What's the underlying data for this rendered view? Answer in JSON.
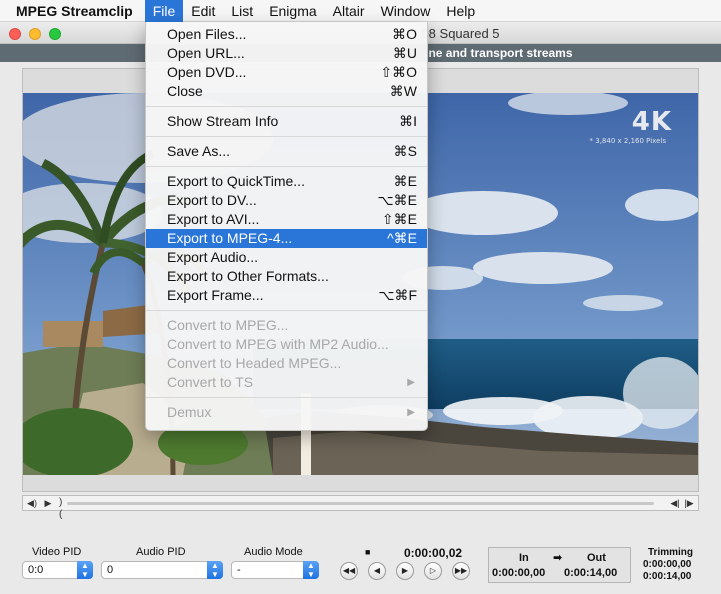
{
  "menubar": {
    "app": "MPEG Streamclip",
    "menus": [
      "File",
      "Edit",
      "List",
      "Enigma",
      "Altair",
      "Window",
      "Help"
    ]
  },
  "window": {
    "title": "08 Squared 5",
    "subtitle": "ne and transport streams"
  },
  "video": {
    "badge": "4K",
    "badge_sub": "* 3,840 x 2,160 Pixels"
  },
  "file_menu": {
    "items": [
      {
        "label": "Open Files...",
        "shortcut": "⌘O"
      },
      {
        "label": "Open URL...",
        "shortcut": "⌘U"
      },
      {
        "label": "Open DVD...",
        "shortcut": "⇧⌘O"
      },
      {
        "label": "Close",
        "shortcut": "⌘W"
      },
      {
        "label": "Show Stream Info",
        "shortcut": "⌘I"
      },
      {
        "label": "Save As...",
        "shortcut": "⌘S"
      },
      {
        "label": "Export to QuickTime...",
        "shortcut": "⌘E"
      },
      {
        "label": "Export to DV...",
        "shortcut": "⌥⌘E"
      },
      {
        "label": "Export to AVI...",
        "shortcut": "⇧⌘E"
      },
      {
        "label": "Export to MPEG-4...",
        "shortcut": "^⌘E"
      },
      {
        "label": "Export Audio...",
        "shortcut": ""
      },
      {
        "label": "Export to Other Formats...",
        "shortcut": ""
      },
      {
        "label": "Export Frame...",
        "shortcut": "⌥⌘F"
      },
      {
        "label": "Convert to MPEG...",
        "shortcut": ""
      },
      {
        "label": "Convert to MPEG with MP2 Audio...",
        "shortcut": ""
      },
      {
        "label": "Convert to Headed MPEG...",
        "shortcut": ""
      },
      {
        "label": "Convert to TS",
        "shortcut": ""
      },
      {
        "label": "Demux",
        "shortcut": ""
      }
    ]
  },
  "controls": {
    "video_pid_label": "Video PID",
    "video_pid_value": "0:0",
    "audio_pid_label": "Audio PID",
    "audio_pid_value": "0",
    "audio_mode_label": "Audio Mode",
    "audio_mode_value": "-",
    "timecode": "0:00:00,02",
    "in_label": "In",
    "out_label": "Out",
    "in_value": "0:00:00,00",
    "out_value": "0:00:14,00",
    "trimming_label": "Trimming",
    "trim_start": "0:00:00,00",
    "trim_end": "0:00:14,00"
  },
  "icons": {
    "volume": "speaker-icon",
    "play": "play-icon",
    "rewind": "rewind-icon",
    "fast_forward": "fast-forward-icon",
    "step_back": "step-back-icon",
    "step_forward": "step-forward-icon",
    "stop": "stop-icon",
    "arrow": "arrow-right-icon"
  }
}
